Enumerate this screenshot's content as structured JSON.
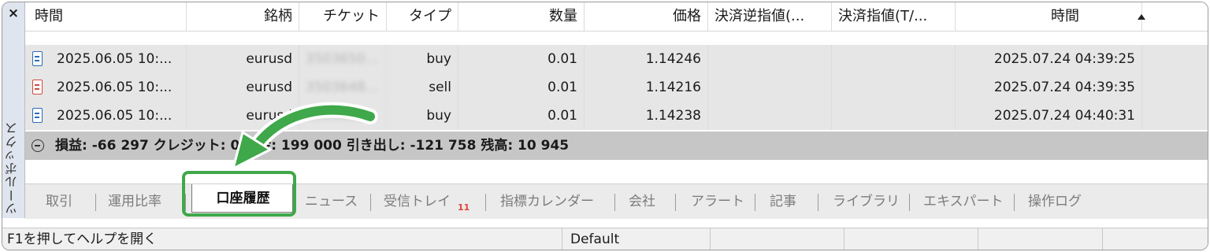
{
  "toolbox": {
    "close_glyph": "×",
    "vertical_title": "ツールボックス"
  },
  "table": {
    "headers": [
      "時間",
      "銘柄",
      "チケット",
      "タイプ",
      "数量",
      "価格",
      "決済逆指値(...",
      "決済指値(T/...",
      "時間"
    ],
    "rows": [
      {
        "open_time": "2025.06.05 10:...",
        "symbol": "eurusd",
        "ticket": "3503650...",
        "type": "buy",
        "volume": "0.01",
        "price": "1.14246",
        "sl": "",
        "tp": "",
        "time": "2025.07.24 04:39:25"
      },
      {
        "open_time": "2025.06.05 10:...",
        "symbol": "eurusd",
        "ticket": "3503648...",
        "type": "sell",
        "volume": "0.01",
        "price": "1.14216",
        "sl": "",
        "tp": "",
        "time": "2025.07.24 04:39:35"
      },
      {
        "open_time": "2025.06.05 10:...",
        "symbol": "eurusd",
        "ticket": "3503651...",
        "type": "buy",
        "volume": "0.01",
        "price": "1.14238",
        "sl": "",
        "tp": "",
        "time": "2025.07.24 04:40:31"
      }
    ],
    "summary": "損益: -66 297  クレジット: 0  入金: 199 000  引き出し: -121 758  残高: 10 945"
  },
  "tabs": {
    "items": [
      "取引",
      "運用比率",
      "口座履歴",
      "ニュース",
      "受信トレイ",
      "指標カレンダー",
      "会社",
      "アラート",
      "記事",
      "ライブラリ",
      "エキスパート",
      "操作ログ"
    ],
    "active": "口座履歴",
    "inbox_badge": "11"
  },
  "statusbar": {
    "help": "F1を押してヘルプを開く",
    "profile": "Default"
  },
  "colors": {
    "highlight": "#3fa84a",
    "buy_icon": "#2a6db8",
    "sell_icon": "#cf4a3c"
  }
}
